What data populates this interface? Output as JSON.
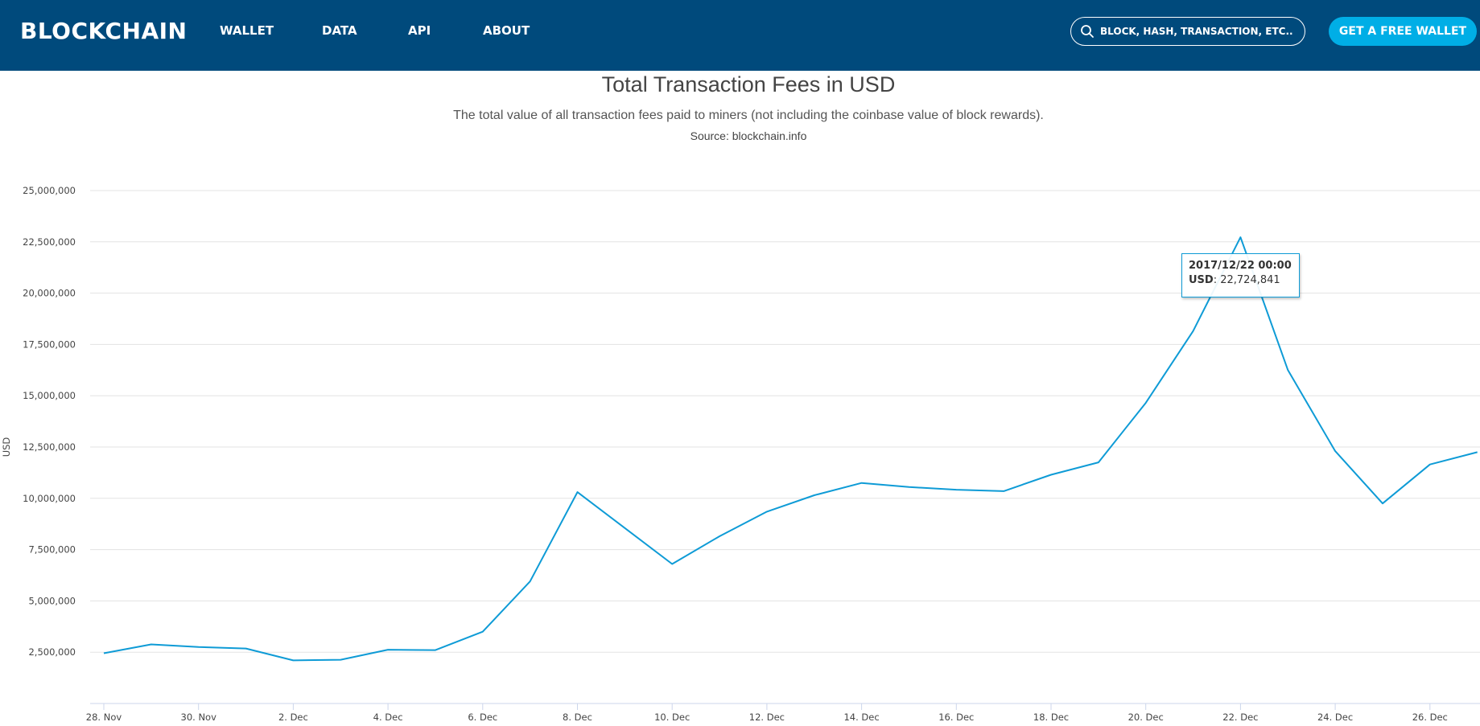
{
  "header": {
    "logo": "BLOCKCHAIN",
    "nav": [
      "WALLET",
      "DATA",
      "API",
      "ABOUT"
    ],
    "search_placeholder": "BLOCK, HASH, TRANSACTION, ETC...",
    "cta_label": "GET A FREE WALLET"
  },
  "colors": {
    "header_bg": "#004a7c",
    "accent": "#00aee6",
    "series_line": "#0e9bd6"
  },
  "chart_data": {
    "type": "line",
    "title": "Total Transaction Fees in USD",
    "subtitle": "The total value of all transaction fees paid to miners (not including the coinbase value of block rewards).",
    "source": "Source: blockchain.info",
    "ylabel": "USD",
    "xlabel": "",
    "ylim": [
      0,
      25000000
    ],
    "y_ticks": [
      "2,500,000",
      "5,000,000",
      "7,500,000",
      "10,000,000",
      "12,500,000",
      "15,000,000",
      "17,500,000",
      "20,000,000",
      "22,500,000",
      "25,000,000"
    ],
    "x_ticks": [
      "28. Nov",
      "30. Nov",
      "2. Dec",
      "4. Dec",
      "6. Dec",
      "8. Dec",
      "10. Dec",
      "12. Dec",
      "14. Dec",
      "16. Dec",
      "18. Dec",
      "20. Dec",
      "22. Dec",
      "24. Dec",
      "26. Dec"
    ],
    "grid": true,
    "legend": "none",
    "series": [
      {
        "x": [
          "2017-11-28",
          "2017-11-29",
          "2017-11-30",
          "2017-12-01",
          "2017-12-02",
          "2017-12-03",
          "2017-12-04",
          "2017-12-05",
          "2017-12-06",
          "2017-12-07",
          "2017-12-08",
          "2017-12-09",
          "2017-12-10",
          "2017-12-11",
          "2017-12-12",
          "2017-12-13",
          "2017-12-14",
          "2017-12-15",
          "2017-12-16",
          "2017-12-17",
          "2017-12-18",
          "2017-12-19",
          "2017-12-20",
          "2017-12-21",
          "2017-12-22",
          "2017-12-23",
          "2017-12-24",
          "2017-12-25",
          "2017-12-26",
          "2017-12-27"
        ],
        "values": [
          2450000,
          2880000,
          2750000,
          2680000,
          2100000,
          2130000,
          2620000,
          2600000,
          3500000,
          5950000,
          10300000,
          8550000,
          6800000,
          8150000,
          9350000,
          10150000,
          10750000,
          10550000,
          10420000,
          10350000,
          11150000,
          11750000,
          14650000,
          18150000,
          22724841,
          16250000,
          12300000,
          9750000,
          11650000,
          12250000
        ]
      }
    ],
    "tooltip": {
      "date": "2017/12/22 00:00",
      "label": "USD",
      "value": "22,724,841"
    }
  }
}
